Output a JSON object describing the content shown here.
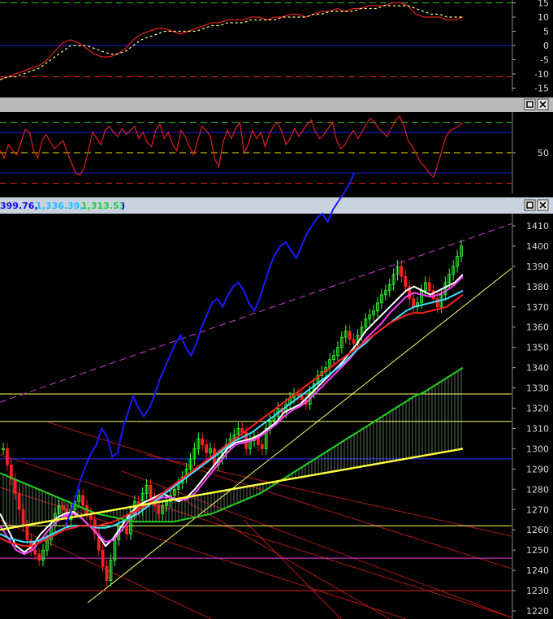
{
  "colors": {
    "background": "#000000",
    "pane_bar": "#b8b8b8",
    "title_bar": "#c9d2df",
    "osc_line": "#e02020",
    "osc_signal": "#ffff88",
    "guide_green": "#30c030",
    "guide_red": "#e02020",
    "guide_blue": "#2020e0",
    "guide_yellow": "#e8e800",
    "candle_up": "#33ff33",
    "candle_down": "#ff2020",
    "ma_white": "#ffffff",
    "ma_magenta": "#ff40ff",
    "ma_cyan": "#40e0ff",
    "ma_red": "#ff2020",
    "ma_green": "#20d020",
    "ma_yellow": "#ffff40",
    "comparison_blue": "#1a1aff",
    "channel_magenta": "#d040d0",
    "cloud": "#c8ffc8",
    "hline_yellow": "#ffff60",
    "hline_magenta": "#e040e0",
    "hline_blue": "#3030ff"
  },
  "icons": [
    "maximize-icon",
    "close-icon"
  ],
  "chart_data": [
    {
      "type": "line",
      "pane": "oscillator",
      "yticks": [
        15,
        10,
        5,
        0,
        -5,
        -10,
        -15
      ],
      "ylim": [
        -16,
        16
      ],
      "guides": [
        {
          "value": 15,
          "color": "green",
          "style": "dashed"
        },
        {
          "value": 0,
          "color": "blue",
          "style": "solid"
        },
        {
          "value": -11,
          "color": "red",
          "style": "dashed"
        }
      ],
      "series": [
        {
          "values": [
            -12,
            -11,
            -10,
            -9,
            -8,
            -7,
            -5,
            -2,
            1,
            2,
            1,
            -1,
            -3,
            -4,
            -4,
            -3,
            -1,
            2,
            4,
            5,
            6,
            6,
            5,
            4,
            5,
            6,
            7,
            8,
            8,
            9,
            9,
            9,
            10,
            10,
            9,
            10,
            10,
            11,
            11,
            10,
            11,
            12,
            12,
            13,
            12,
            13,
            13,
            14,
            14,
            14,
            15,
            15,
            14,
            11,
            10,
            10,
            10,
            9,
            9,
            10
          ]
        },
        {
          "values": [
            -12,
            -11,
            -11,
            -10,
            -9,
            -8,
            -6,
            -4,
            -2,
            0,
            0,
            0,
            -1,
            -2,
            -3,
            -3,
            -2,
            0,
            2,
            3,
            4,
            5,
            5,
            5,
            5,
            5,
            6,
            7,
            7,
            8,
            8,
            8,
            9,
            9,
            9,
            9,
            10,
            10,
            10,
            10,
            11,
            11,
            12,
            12,
            12,
            12,
            13,
            13,
            13,
            14,
            14,
            14,
            14,
            13,
            12,
            11,
            11,
            10,
            10,
            10
          ]
        }
      ]
    },
    {
      "type": "line",
      "pane": "momentum",
      "yticks": [
        50
      ],
      "ylim": [
        10,
        90
      ],
      "guides": [
        {
          "value": 80,
          "color": "green",
          "style": "dashed"
        },
        {
          "value": 70,
          "color": "blue",
          "style": "solid"
        },
        {
          "value": 50,
          "color": "yellow",
          "style": "dashed"
        },
        {
          "value": 30,
          "color": "blue",
          "style": "solid"
        },
        {
          "value": 20,
          "color": "red",
          "style": "dashed"
        }
      ],
      "series": [
        {
          "values": [
            52,
            45,
            58,
            52,
            48,
            60,
            73,
            70,
            52,
            45,
            62,
            68,
            60,
            54,
            58,
            62,
            50,
            40,
            30,
            28,
            35,
            52,
            70,
            64,
            58,
            72,
            76,
            70,
            66,
            74,
            68,
            72,
            76,
            64,
            70,
            60,
            56,
            72,
            78,
            64,
            70,
            58,
            52,
            72,
            66,
            56,
            48,
            62,
            76,
            72,
            66,
            44,
            36,
            60,
            72,
            64,
            74,
            80,
            50,
            58,
            72,
            64,
            70,
            56,
            68,
            76,
            80,
            70,
            58,
            64,
            74,
            66,
            72,
            78,
            82,
            70,
            64,
            68,
            74,
            80,
            62,
            54,
            58,
            66,
            72,
            64,
            70,
            78,
            84,
            80,
            74,
            70,
            66,
            74,
            82,
            86,
            76,
            62,
            56,
            48,
            40,
            36,
            30,
            26,
            38,
            52,
            66,
            72,
            74,
            76,
            80
          ]
        }
      ]
    },
    {
      "type": "line",
      "pane": "price",
      "yticks": [
        1410,
        1400,
        1390,
        1380,
        1370,
        1360,
        1350,
        1340,
        1330,
        1320,
        1310,
        1300,
        1290,
        1280,
        1270,
        1260,
        1250,
        1240,
        1230,
        1220
      ],
      "ylim": [
        1216,
        1416
      ],
      "title_values": [
        "399.76,",
        "1,336.39,",
        "1,313.53",
        ")"
      ],
      "horizontal_lines": [
        {
          "value": 1327,
          "color": "yellow"
        },
        {
          "value": 1313.5,
          "color": "yellow"
        },
        {
          "value": 1295,
          "color": "blue"
        },
        {
          "value": 1262,
          "color": "yellow"
        },
        {
          "value": 1246,
          "color": "magenta"
        },
        {
          "value": 1230,
          "color": "red"
        }
      ],
      "candles_close": [
        1300,
        1292,
        1285,
        1278,
        1270,
        1262,
        1255,
        1250,
        1248,
        1245,
        1250,
        1255,
        1262,
        1268,
        1272,
        1270,
        1265,
        1270,
        1274,
        1277,
        1272,
        1268,
        1265,
        1258,
        1250,
        1242,
        1235,
        1245,
        1255,
        1262,
        1262,
        1258,
        1268,
        1274,
        1270,
        1278,
        1282,
        1276,
        1272,
        1268,
        1272,
        1274,
        1277,
        1280,
        1283,
        1286,
        1290,
        1295,
        1300,
        1305,
        1302,
        1298,
        1300,
        1292,
        1295,
        1298,
        1302,
        1305,
        1307,
        1310,
        1308,
        1300,
        1304,
        1306,
        1302,
        1300,
        1310,
        1314,
        1316,
        1320,
        1318,
        1322,
        1325,
        1327,
        1326,
        1324,
        1322,
        1328,
        1332,
        1336,
        1338,
        1340,
        1344,
        1346,
        1350,
        1355,
        1358,
        1354,
        1352,
        1356,
        1360,
        1364,
        1366,
        1368,
        1372,
        1376,
        1378,
        1381,
        1386,
        1390,
        1385,
        1380,
        1374,
        1370,
        1372,
        1378,
        1382,
        1378,
        1374,
        1370,
        1376,
        1382,
        1386,
        1390,
        1395,
        1400
      ],
      "series": [
        {
          "name": "",
          "color": "ma_white",
          "values": [
            1268,
            1260,
            1252,
            1249,
            1252,
            1258,
            1262,
            1266,
            1268,
            1269,
            1266,
            1262,
            1258,
            1252,
            1256,
            1262,
            1268,
            1272,
            1274,
            1276,
            1278,
            1276,
            1274,
            1276,
            1280,
            1285,
            1290,
            1295,
            1300,
            1303,
            1304,
            1305,
            1307,
            1310,
            1313,
            1318,
            1320,
            1322,
            1326,
            1330,
            1334,
            1338,
            1342,
            1347,
            1352,
            1358,
            1362,
            1366,
            1370,
            1374,
            1378,
            1380,
            1378,
            1376,
            1378,
            1380,
            1382,
            1386
          ]
        },
        {
          "name": "",
          "color": "ma_magenta",
          "values": [
            1262,
            1256,
            1250,
            1248,
            1250,
            1255,
            1260,
            1264,
            1267,
            1268,
            1266,
            1262,
            1258,
            1254,
            1255,
            1260,
            1265,
            1270,
            1272,
            1274,
            1276,
            1276,
            1275,
            1275,
            1278,
            1283,
            1288,
            1293,
            1298,
            1302,
            1303,
            1304,
            1306,
            1309,
            1312,
            1316,
            1319,
            1321,
            1324,
            1328,
            1332,
            1336,
            1340,
            1344,
            1349,
            1354,
            1358,
            1362,
            1367,
            1371,
            1375,
            1377,
            1376,
            1375,
            1376,
            1378,
            1381,
            1385
          ]
        },
        {
          "name": "",
          "color": "ma_cyan",
          "values": [
            1258,
            1256,
            1255,
            1254,
            1254,
            1255,
            1257,
            1259,
            1261,
            1262,
            1262,
            1262,
            1261,
            1261,
            1262,
            1264,
            1266,
            1268,
            1271,
            1274,
            1277,
            1280,
            1283,
            1286,
            1289,
            1292,
            1295,
            1298,
            1301,
            1304,
            1306,
            1308,
            1311,
            1314,
            1317,
            1320,
            1323,
            1326,
            1329,
            1332,
            1335,
            1338,
            1341,
            1345,
            1349,
            1352,
            1356,
            1359,
            1362,
            1365,
            1368,
            1370,
            1371,
            1372,
            1373,
            1374,
            1376,
            1378
          ]
        },
        {
          "name": "",
          "color": "ma_red",
          "values": [
            1256,
            1254,
            1253,
            1252,
            1252,
            1254,
            1256,
            1258,
            1260,
            1261,
            1262,
            1262,
            1262,
            1263,
            1264,
            1266,
            1268,
            1270,
            1272,
            1275,
            1278,
            1281,
            1284,
            1287,
            1290,
            1293,
            1296,
            1299,
            1302,
            1305,
            1308,
            1311,
            1314,
            1317,
            1320,
            1323,
            1326,
            1329,
            1332,
            1335,
            1338,
            1341,
            1344,
            1347,
            1350,
            1353,
            1356,
            1359,
            1362,
            1364,
            1366,
            1367,
            1367,
            1368,
            1369,
            1370,
            1373,
            1376
          ]
        },
        {
          "name": "",
          "color": "ma_green",
          "values": [
            1288,
            1286,
            1284,
            1282,
            1280,
            1278,
            1276,
            1274,
            1272,
            1270,
            1268,
            1267,
            1266,
            1265,
            1264,
            1264,
            1264,
            1264,
            1264,
            1265,
            1266,
            1267,
            1268,
            1270,
            1272,
            1274,
            1276,
            1278,
            1281,
            1284,
            1287,
            1290,
            1293,
            1296,
            1299,
            1302,
            1305,
            1308,
            1311,
            1314,
            1317,
            1320,
            1323,
            1326,
            1328,
            1331,
            1334,
            1337,
            1340
          ]
        },
        {
          "name": "",
          "color": "ma_yellow",
          "values": [
            1260,
            1261,
            1262,
            1263,
            1264,
            1265,
            1266,
            1267,
            1268,
            1269,
            1270,
            1271,
            1272,
            1273,
            1274,
            1275,
            1276,
            1277,
            1278,
            1279,
            1280,
            1281,
            1282,
            1283,
            1284,
            1285,
            1286,
            1287,
            1288,
            1289,
            1290,
            1291,
            1292,
            1293,
            1294,
            1295,
            1296,
            1297,
            1298,
            1299,
            1300
          ]
        },
        {
          "name": "",
          "color": "comparison_blue",
          "values": [
            1262,
            1268,
            1276,
            1285,
            1292,
            1298,
            1302,
            1310,
            1306,
            1296,
            1298,
            1310,
            1318,
            1326,
            1320,
            1316,
            1320,
            1326,
            1334,
            1340,
            1346,
            1352,
            1356,
            1350,
            1346,
            1352,
            1360,
            1366,
            1372,
            1374,
            1370,
            1376,
            1380,
            1382,
            1378,
            1372,
            1368,
            1374,
            1382,
            1390,
            1396,
            1400,
            1402,
            1398,
            1394,
            1400,
            1406,
            1410,
            1414,
            1416,
            1412,
            1418,
            1422,
            1426,
            1430,
            1436
          ]
        }
      ]
    }
  ]
}
